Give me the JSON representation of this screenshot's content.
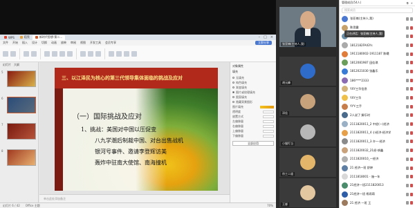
{
  "wps": {
    "tabs": [
      {
        "label": "WPS",
        "color": "#d64532"
      },
      {
        "label": "稻壳",
        "color": "#e8a23b"
      },
      {
        "label": "新时代思想-第二...",
        "color": "#d25b2a"
      }
    ],
    "menus": [
      "文件",
      "开始",
      "插入",
      "设计",
      "切换",
      "动画",
      "放映",
      "审阅",
      "视图",
      "开发工具",
      "会员专享"
    ],
    "menu_action": "立即分享",
    "thumb_tabs": [
      "幻灯片",
      "大纲"
    ],
    "thumb_numbers": [
      "5",
      "6",
      "7",
      "8"
    ],
    "slide": {
      "header": "三、以江泽民为核心的第三代领导集体面临的挑战及应对",
      "h1": "（一）国际挑战及应对",
      "h2": "1、挑战：美国对中国以压促变",
      "lines": [
        "八九学潮后制裁中国、对台出售战机",
        "银河号事件、邀请李登辉访美",
        "轰炸中驻南大使馆、南海撞机"
      ]
    },
    "notes_placeholder": "单击此处添加备注",
    "pane": {
      "title": "对象属性",
      "section": "填充",
      "options": [
        "无填充",
        "纯色填充",
        "渐变填充",
        "图片或纹理填充",
        "图案填充",
        "隐藏背景图形"
      ],
      "selected_option": 3,
      "fields": [
        "图片填充",
        "透明度",
        "放置方式",
        "左偏移量",
        "右偏移量",
        "上偏移量",
        "下偏移量"
      ],
      "button": "全部应用"
    },
    "status": {
      "slide": "幻灯片 6 / 42",
      "theme": "Office 主题",
      "zoom": "70%"
    }
  },
  "videos": [
    {
      "name": "张亚楠(主持人,我)",
      "color": "#6d7a83",
      "type": "person"
    },
    {
      "name": "胡元峰",
      "color": "#2f6cc9",
      "type": "avatar"
    },
    {
      "name": "邓佳",
      "color": "#c8a27a",
      "type": "avatar"
    },
    {
      "name": "小猫叮当",
      "color": "#b7b7b7",
      "type": "avatar"
    },
    {
      "name": "徐工二道",
      "color": "#e2b56a",
      "type": "avatar"
    },
    {
      "name": "王娜",
      "color": "#e2c7a0",
      "type": "avatar"
    }
  ],
  "plist": {
    "title": "管理成员(54人)",
    "search_placeholder": "搜索成员",
    "tooltip": "正在讲话：张亚楠(主持人,我)",
    "rows": [
      {
        "name": "张亚楠(主持人,我)",
        "color": "#4a78d0",
        "mic_off": false
      },
      {
        "name": "陈思露",
        "color": "#c7a16a",
        "mic_off": true
      },
      {
        "name": "1812021 蔡宇(17)",
        "color": "#6b8fa6",
        "mic_off": true
      },
      {
        "name": "1812182FAIGYs",
        "color": "#aaa",
        "mic_off": true
      },
      {
        "name": "1911180002-1911187 陈曦",
        "color": "#e07d3a",
        "mic_off": true
      },
      {
        "name": "1812081987 田佳琪",
        "color": "#6b9e5a",
        "mic_off": true
      },
      {
        "name": "1812021030 张鑫乐",
        "color": "#3a7bd5",
        "mic_off": true
      },
      {
        "name": "186****2333",
        "color": "#8b6bb1",
        "mic_off": true
      },
      {
        "name": "YXY三华信息",
        "color": "#d3b47a",
        "mic_off": true
      },
      {
        "name": "YXY三华",
        "color": "#f0c14a",
        "mic_off": true
      },
      {
        "name": "YYY-三手",
        "color": "#c77e4b",
        "mic_off": true
      },
      {
        "name": "2人说了 解乐时",
        "color": "#4a6b8c",
        "mic_off": true
      },
      {
        "name": "2111820011_2 中经(一)经济",
        "color": "#9ab0c5",
        "mic_off": true
      },
      {
        "name": "2111820011_4 小经济-经济学",
        "color": "#e6a04a",
        "mic_off": true
      },
      {
        "name": "2111820011_3 许一-经济",
        "color": "#8a8a8a",
        "mic_off": true
      },
      {
        "name": "2111820032_21经-胡鑫",
        "color": "#c9a27c",
        "mic_off": true
      },
      {
        "name": "2111820010_一经济",
        "color": "#b0b0b0",
        "mic_off": true
      },
      {
        "name": "21 经济一班 舒婷",
        "color": "#5e7fa3",
        "mic_off": true
      },
      {
        "name": "2111818001 - 施一年",
        "color": "#d8d8d8",
        "mic_off": true
      },
      {
        "name": "21经济一班2111820013",
        "color": "#4a8c6b",
        "mic_off": true
      },
      {
        "name": "21经济一班 杨雨萌",
        "color": "#2f5ea8",
        "mic_off": true
      },
      {
        "name": "21 经济 一班 王",
        "color": "#9c7a5e",
        "mic_off": true
      }
    ]
  }
}
